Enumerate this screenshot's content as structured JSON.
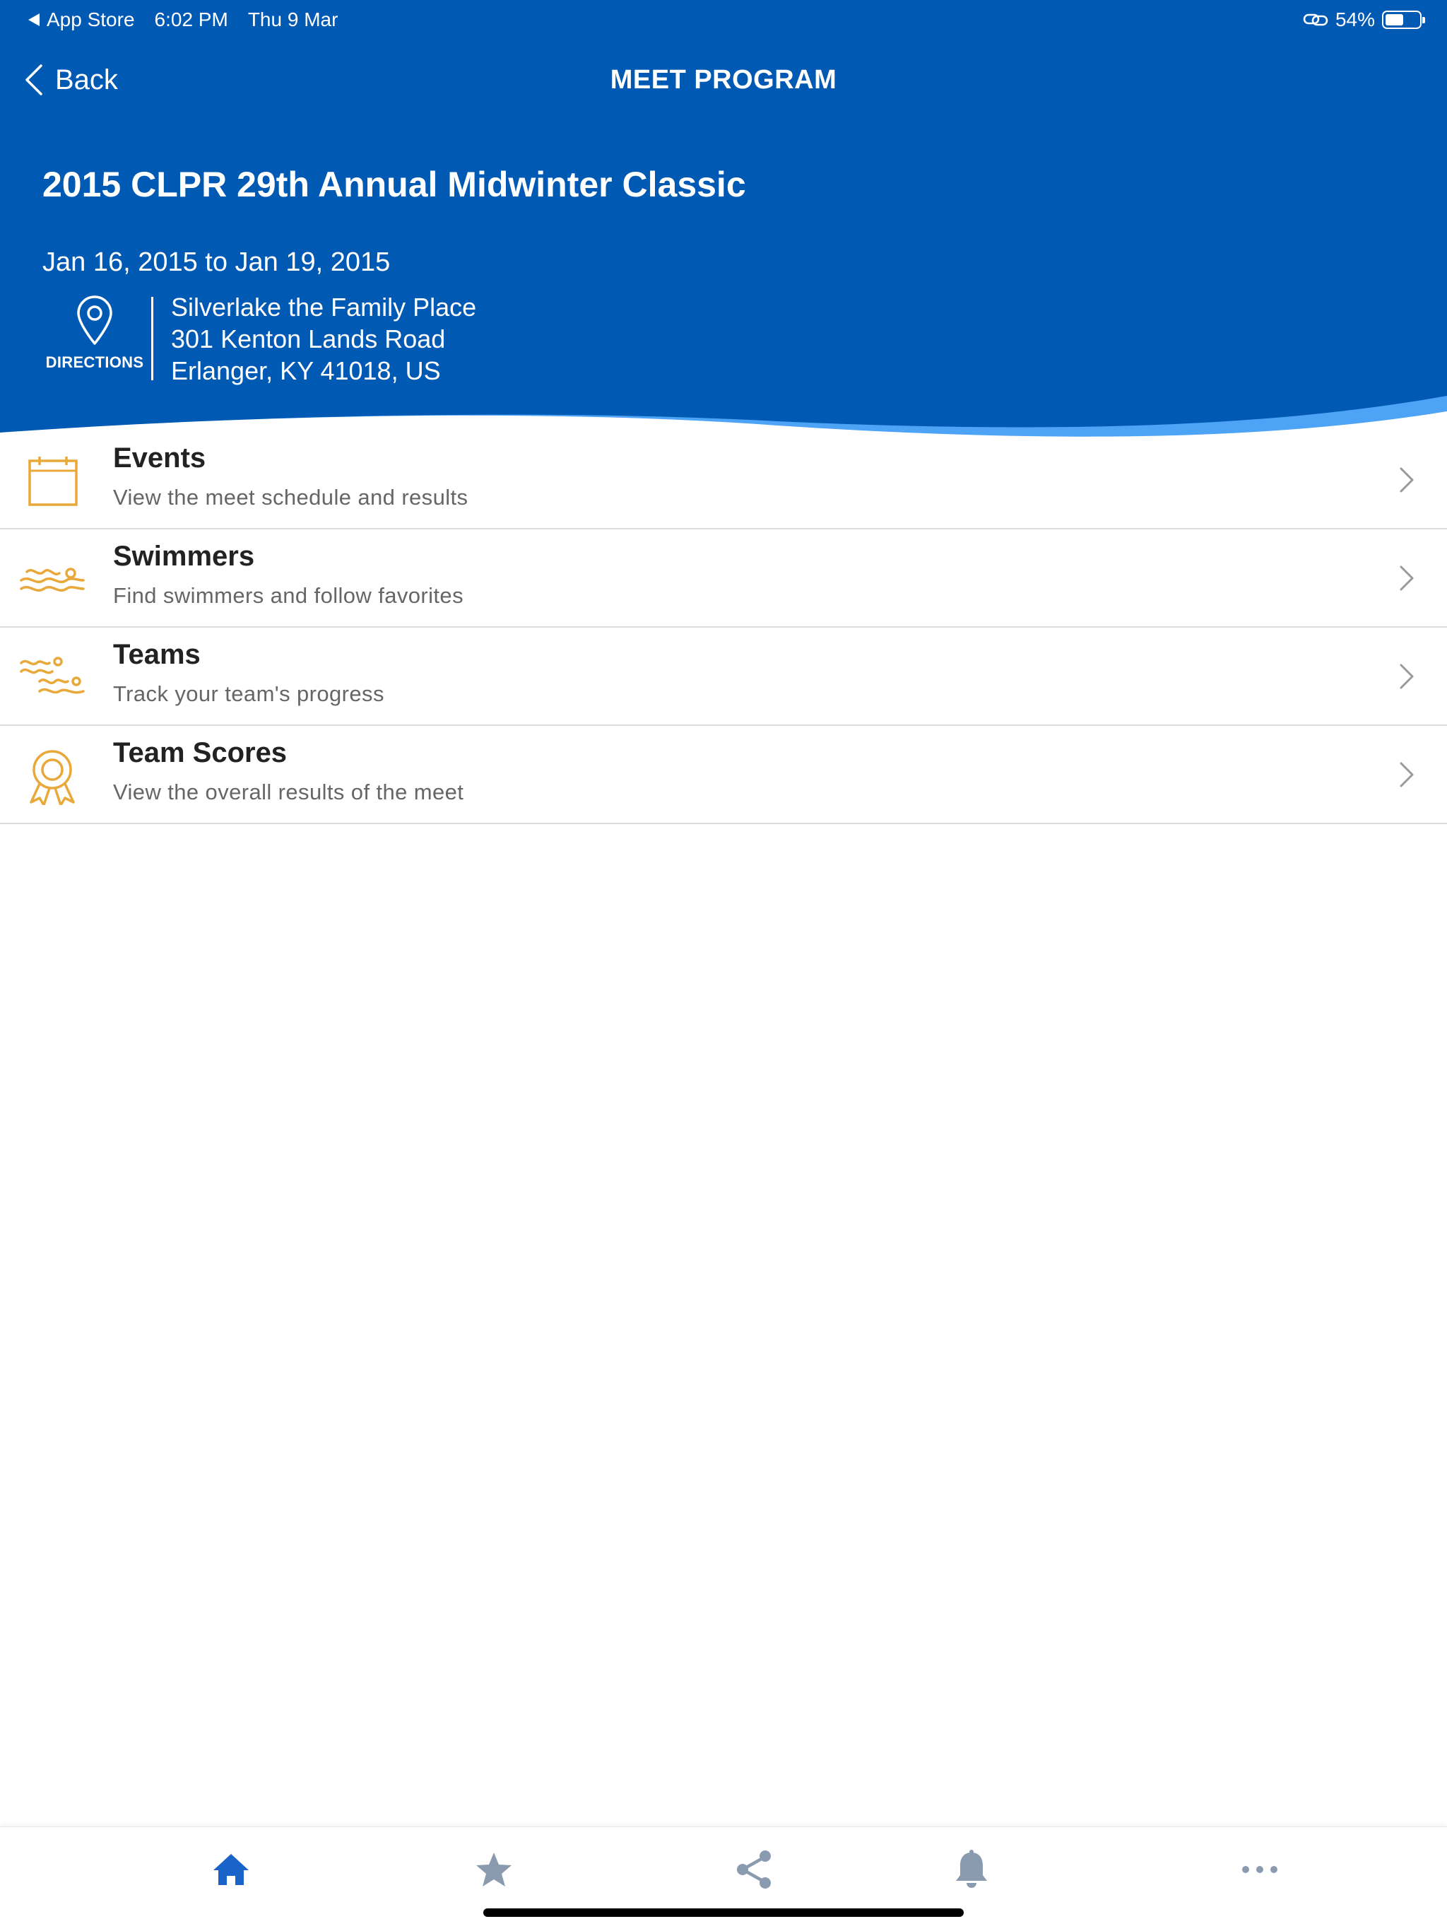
{
  "status_bar": {
    "back_app": "App Store",
    "time": "6:02 PM",
    "date": "Thu 9 Mar",
    "battery": "54%",
    "battery_level": 0.54
  },
  "nav": {
    "back_label": "Back",
    "title": "MEET PROGRAM"
  },
  "meet": {
    "title": "2015 CLPR 29th Annual Midwinter Classic",
    "dates": "Jan 16, 2015 to Jan 19, 2015",
    "directions_label": "DIRECTIONS",
    "venue": "Silverlake the Family Place",
    "street": "301 Kenton Lands Road",
    "city": "Erlanger, KY 41018, US"
  },
  "menu": [
    {
      "title": "Events",
      "subtitle": "View the meet schedule and results",
      "icon": "calendar-icon"
    },
    {
      "title": "Swimmers",
      "subtitle": "Find swimmers and follow favorites",
      "icon": "swimmer-icon"
    },
    {
      "title": "Teams",
      "subtitle": "Track your team's progress",
      "icon": "team-swimmers-icon"
    },
    {
      "title": "Team Scores",
      "subtitle": "View the overall results of the meet",
      "icon": "award-ribbon-icon"
    }
  ],
  "tabs": [
    {
      "icon": "home-icon",
      "active": true
    },
    {
      "icon": "star-icon",
      "active": false
    },
    {
      "icon": "share-icon",
      "active": false
    },
    {
      "icon": "bell-icon",
      "active": false
    },
    {
      "icon": "more-icon",
      "active": false
    }
  ],
  "colors": {
    "header_blue": "#0059b3",
    "wave_light_blue": "#4da3f5",
    "accent_gold": "#e8a83a",
    "tab_active": "#1a63c9",
    "tab_inactive": "#8a9bb0"
  }
}
